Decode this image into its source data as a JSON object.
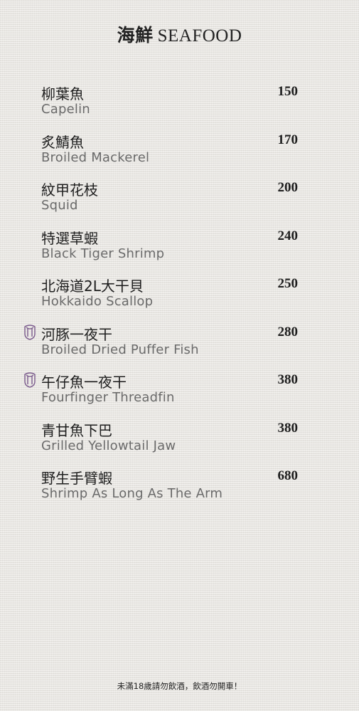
{
  "header": {
    "title_zh": "海鮮",
    "title_en": "SEAFOOD"
  },
  "items": [
    {
      "zh": "柳葉魚",
      "en": "Capelin",
      "price": "150",
      "badge": false
    },
    {
      "zh": "炙鯖魚",
      "en": "Broiled Mackerel",
      "price": "170",
      "badge": false
    },
    {
      "zh": "紋甲花枝",
      "en": "Squid",
      "price": "200",
      "badge": false
    },
    {
      "zh": "特選草蝦",
      "en": "Black Tiger Shrimp",
      "price": "240",
      "badge": false
    },
    {
      "zh": "北海道2L大干貝",
      "en": "Hokkaido Scallop",
      "price": "250",
      "badge": false
    },
    {
      "zh": "河豚一夜干",
      "en": "Broiled Dried Puffer Fish",
      "price": "280",
      "badge": true
    },
    {
      "zh": "午仔魚一夜干",
      "en": "Fourfinger Threadfin",
      "price": "380",
      "badge": true
    },
    {
      "zh": "青甘魚下巴",
      "en": "Grilled Yellowtail Jaw",
      "price": "380",
      "badge": false
    },
    {
      "zh": "野生手臂蝦",
      "en": "Shrimp As Long As The Arm",
      "price": "680",
      "badge": false
    }
  ],
  "badge_icon": "recommended-crest-icon",
  "badge_color": "#7a5a8c",
  "footer": {
    "notice": "未滿18歲請勿飲酒，飲酒勿開車！"
  }
}
